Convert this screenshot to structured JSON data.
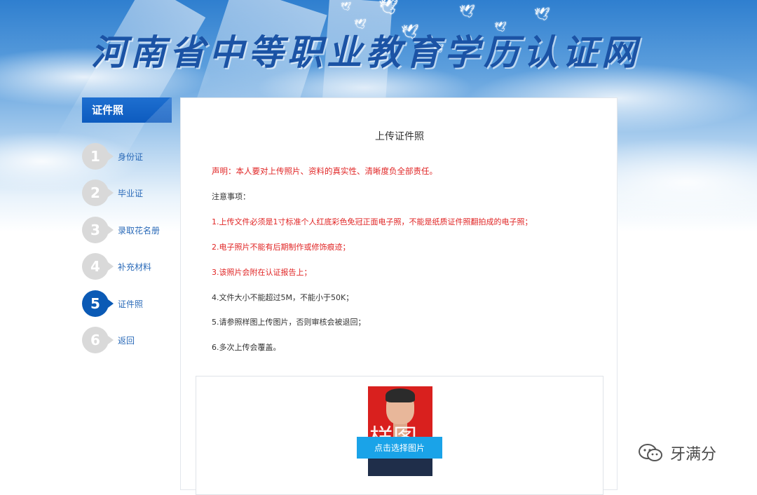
{
  "site": {
    "title": "河南省中等职业教育学历认证网"
  },
  "sidebar": {
    "header": "证件照",
    "steps": [
      {
        "num": "1",
        "label": "身份证",
        "active": false
      },
      {
        "num": "2",
        "label": "毕业证",
        "active": false
      },
      {
        "num": "3",
        "label": "录取花名册",
        "active": false
      },
      {
        "num": "4",
        "label": "补充材料",
        "active": false
      },
      {
        "num": "5",
        "label": "证件照",
        "active": true
      },
      {
        "num": "6",
        "label": "返回",
        "active": false
      }
    ]
  },
  "main": {
    "title": "上传证件照",
    "statement": "声明：本人要对上传照片、资料的真实性、清晰度负全部责任。",
    "notes_heading": "注意事项：",
    "notes": [
      "1.上传文件必须是1寸标准个人红底彩色免冠正面电子照，不能是纸质证件照翻拍成的电子照；",
      "2.电子照片不能有后期制作或修饰痕迹；",
      "3.该照片会附在认证报告上；",
      "4.文件大小不能超过5M，不能小于50K；",
      "5.请参照样图上传图片，否则审核会被退回；",
      "6.多次上传会覆盖。"
    ],
    "sample_watermark": "样图",
    "choose_button": "点击选择图片"
  },
  "watermark": {
    "text": "牙满分"
  },
  "colors": {
    "accent_blue": "#0b5ab5",
    "warning_red": "#e02424",
    "button_blue": "#1aa3e8",
    "step_gray": "#d9d9d9"
  }
}
